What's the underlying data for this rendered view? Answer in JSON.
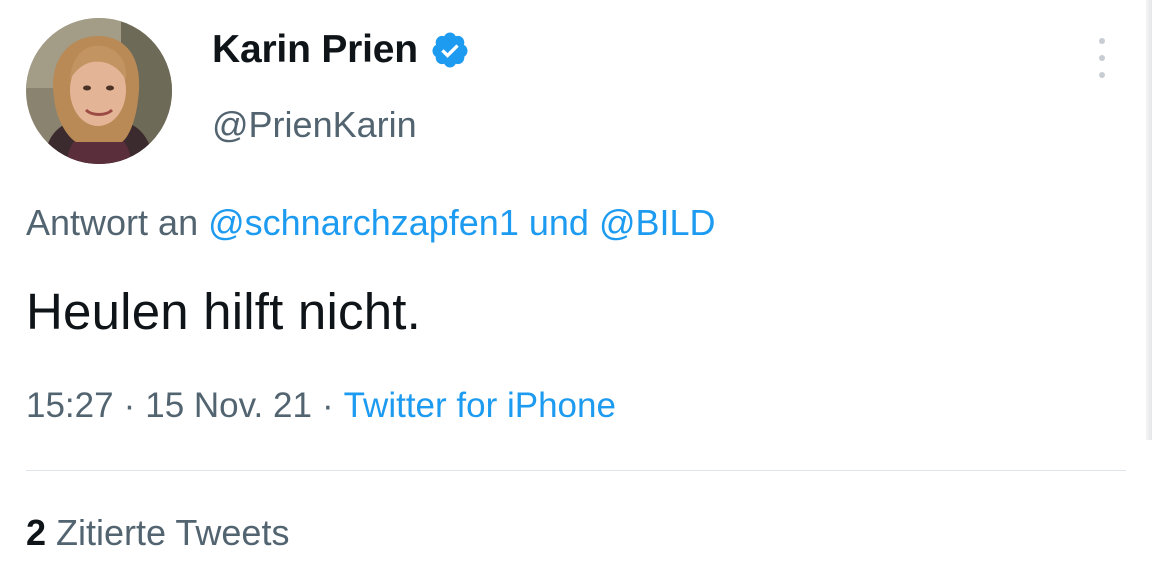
{
  "author": {
    "display_name": "Karin Prien",
    "handle": "@PrienKarin",
    "verified_icon": "verified-badge-icon",
    "avatar_icon": "profile-photo"
  },
  "more_icon": "more-options-icon",
  "reply": {
    "prefix": "Antwort an",
    "user1": "@schnarchzapfen1",
    "joiner": "und",
    "user2": "@BILD"
  },
  "tweet": {
    "text": "Heulen hilft nicht."
  },
  "meta": {
    "time": "15:27",
    "separator": "·",
    "date": "15 Nov. 21",
    "source": "Twitter for iPhone"
  },
  "quotes": {
    "count": "2",
    "label": "Zitierte Tweets"
  },
  "colors": {
    "link": "#1d9bf0",
    "secondary_text": "#536471",
    "primary_text": "#0f1419",
    "verified": "#1d9bf0"
  }
}
